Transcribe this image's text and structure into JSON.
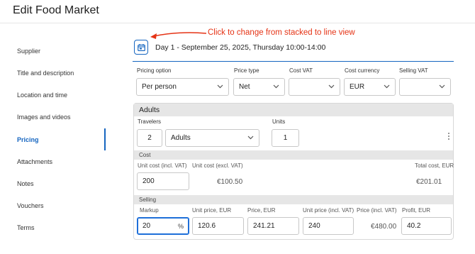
{
  "page": {
    "title": "Edit Food Market"
  },
  "sidebar": {
    "items": [
      {
        "label": "Supplier"
      },
      {
        "label": "Title and description"
      },
      {
        "label": "Location and time"
      },
      {
        "label": "Images and videos"
      },
      {
        "label": "Pricing",
        "active": true
      },
      {
        "label": "Attachments"
      },
      {
        "label": "Notes"
      },
      {
        "label": "Vouchers"
      },
      {
        "label": "Terms"
      }
    ]
  },
  "annotation": {
    "text": "Click to change from stacked to line view",
    "color": "#e53315"
  },
  "header": {
    "day": "Day 1 - September 25, 2025, Thursday 10:00-14:00"
  },
  "pricing_row": {
    "pricing_option": {
      "label": "Pricing option",
      "value": "Per person"
    },
    "price_type": {
      "label": "Price type",
      "value": "Net"
    },
    "cost_vat": {
      "label": "Cost VAT",
      "value": ""
    },
    "cost_currency": {
      "label": "Cost currency",
      "value": "EUR"
    },
    "selling_vat": {
      "label": "Selling VAT",
      "value": ""
    }
  },
  "adults": {
    "title": "Adults",
    "travelers_label": "Travelers",
    "travelers_count": "2",
    "travelers_type": "Adults",
    "units_label": "Units",
    "units_value": "1"
  },
  "cost": {
    "title": "Cost",
    "unit_cost_incl_label": "Unit cost (incl. VAT)",
    "unit_cost_incl_value": "200",
    "unit_cost_excl_label": "Unit cost (excl. VAT)",
    "unit_cost_excl_value": "€100.50",
    "total_cost_label": "Total cost, EUR",
    "total_cost_value": "€201.01"
  },
  "selling": {
    "title": "Selling",
    "markup_label": "Markup",
    "markup_value": "20",
    "markup_unit": "%",
    "unit_price_label": "Unit price, EUR",
    "unit_price_value": "120.6",
    "price_label": "Price, EUR",
    "price_value": "241.21",
    "unit_price_incl_label": "Unit price (incl. VAT)",
    "unit_price_incl_value": "240",
    "price_incl_label": "Price (incl. VAT)",
    "price_incl_value": "€480.00",
    "profit_label": "Profit, EUR",
    "profit_value": "40.2"
  },
  "colors": {
    "accent": "#1565c0",
    "annotation": "#e53315",
    "section_header_bg": "#e6e6e6"
  }
}
